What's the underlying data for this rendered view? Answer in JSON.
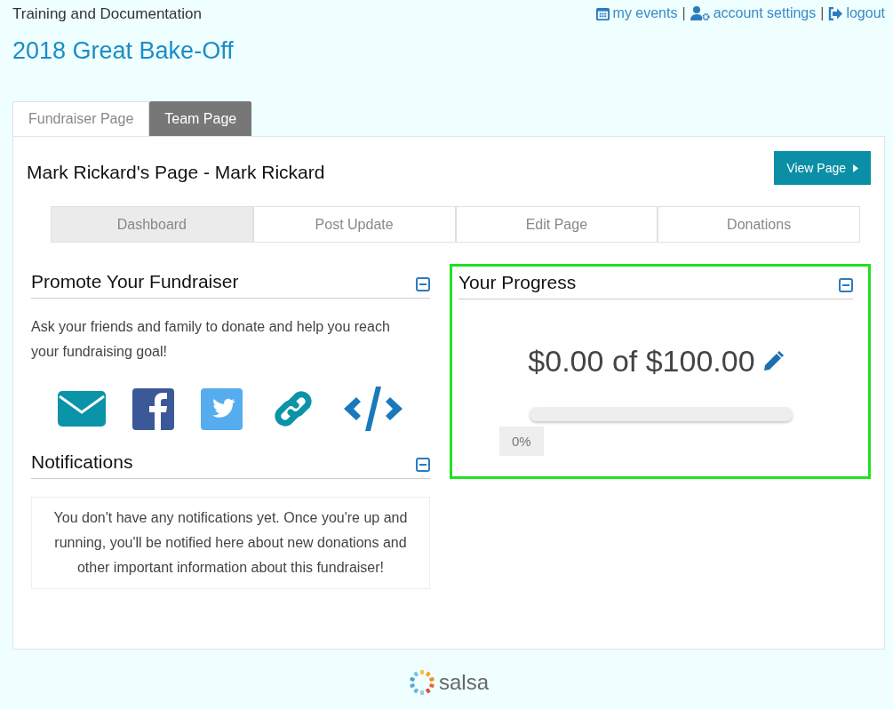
{
  "header": {
    "org": "Training and Documentation",
    "event_title": "2018 Great Bake-Off",
    "links": [
      {
        "kind": "calendar",
        "label": "my events"
      },
      {
        "kind": "user",
        "label": "account settings"
      },
      {
        "kind": "logout",
        "label": "logout"
      }
    ],
    "separator": "|"
  },
  "page_tabs": [
    {
      "label": "Fundraiser Page",
      "selected": true
    },
    {
      "label": "Team Page",
      "selected": false
    }
  ],
  "page_heading": "Mark Rickard's Page - Mark Rickard",
  "view_button": "View Page",
  "sub_tabs": [
    {
      "label": "Dashboard",
      "selected": true
    },
    {
      "label": "Post Update",
      "selected": false
    },
    {
      "label": "Edit Page",
      "selected": false
    },
    {
      "label": "Donations",
      "selected": false
    }
  ],
  "promote": {
    "title": "Promote Your Fundraiser",
    "text": "Ask your friends and family to donate and help you reach your fundraising goal!",
    "share": [
      {
        "kind": "email"
      },
      {
        "kind": "facebook"
      },
      {
        "kind": "twitter"
      },
      {
        "kind": "link"
      },
      {
        "kind": "embed"
      }
    ]
  },
  "notifications": {
    "title": "Notifications",
    "text": "You don't have any notifications yet. Once you're up and running, you'll be notified here about new donations and other important information about this fundraiser!"
  },
  "progress": {
    "title": "Your Progress",
    "highlighted": true,
    "amount": "$0.00 of $100.00",
    "level": 0,
    "percent": "0%"
  },
  "footer": {
    "brand": "salsa"
  }
}
